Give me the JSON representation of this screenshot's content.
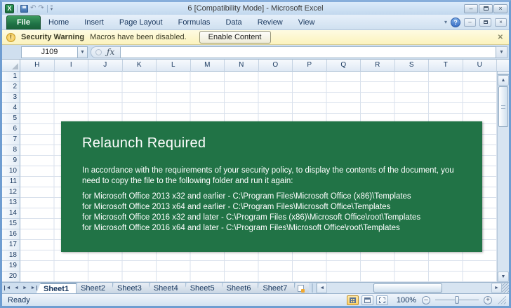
{
  "window": {
    "title": "6  [Compatibility Mode] - Microsoft Excel"
  },
  "ribbon": {
    "tabs": [
      {
        "label": "File"
      },
      {
        "label": "Home"
      },
      {
        "label": "Insert"
      },
      {
        "label": "Page Layout"
      },
      {
        "label": "Formulas"
      },
      {
        "label": "Data"
      },
      {
        "label": "Review"
      },
      {
        "label": "View"
      }
    ]
  },
  "security_bar": {
    "label": "Security Warning",
    "message": "Macros have been disabled.",
    "button_label": "Enable Content",
    "icon": "shield-exclamation-icon",
    "bg_color": "#fdf6c5"
  },
  "formula_bar": {
    "name_box_value": "J109",
    "fx_label": "ƒx"
  },
  "grid": {
    "column_headers": [
      "H",
      "I",
      "J",
      "K",
      "L",
      "M",
      "N",
      "O",
      "P",
      "Q",
      "R",
      "S",
      "T",
      "U"
    ],
    "row_headers": [
      "1",
      "2",
      "3",
      "4",
      "5",
      "6",
      "7",
      "8",
      "9",
      "10",
      "11",
      "12",
      "13",
      "14",
      "15",
      "16",
      "17",
      "18",
      "19",
      "20"
    ]
  },
  "dialog": {
    "title": "Relaunch Required",
    "body": "In accordance with the requirements of your security policy, to display the contents of the document, you need to copy the file to the following folder and run it again:",
    "paths": [
      "for Microsoft Office 2013 x32 and earlier - C:\\Program Files\\Microsoft Office (x86)\\Templates",
      "for Microsoft Office 2013 x64 and earlier - C:\\Program Files\\Microsoft Office\\Templates",
      "for Microsoft Office 2016 x32 and later - C:\\Program Files (x86)\\Microsoft Office\\root\\Templates",
      "for Microsoft Office 2016 x64 and later - C:\\Program Files\\Microsoft Office\\root\\Templates"
    ],
    "bg_color": "#217346"
  },
  "sheet_bar": {
    "tabs": [
      {
        "label": "Sheet1",
        "active": true
      },
      {
        "label": "Sheet2",
        "active": false
      },
      {
        "label": "Sheet3",
        "active": false
      },
      {
        "label": "Sheet4",
        "active": false
      },
      {
        "label": "Sheet5",
        "active": false
      },
      {
        "label": "Sheet6",
        "active": false
      },
      {
        "label": "Sheet7",
        "active": false
      }
    ]
  },
  "status_bar": {
    "status": "Ready",
    "zoom_level": "100%"
  }
}
